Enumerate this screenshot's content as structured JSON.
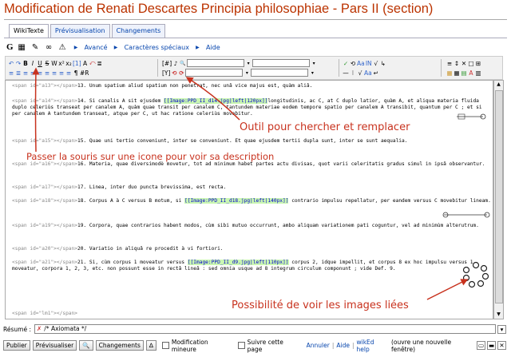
{
  "page": {
    "title": "Modification de Renati Descartes Principia philosophiae - Pars II (section)"
  },
  "tabs": [
    {
      "label": "WikiTexte",
      "active": true
    },
    {
      "label": "Prévisualisation",
      "active": false
    },
    {
      "label": "Changements",
      "active": false
    }
  ],
  "toolbar": {
    "g_label": "G",
    "advanced_label": "Avancé",
    "special_chars_label": "Caractères spéciaux",
    "help_label": "Aide",
    "row1": [
      "↶",
      "↷",
      "B",
      "I",
      "U",
      "S",
      "W",
      "x²",
      "x₂",
      "[1]",
      "A",
      "⤺",
      "≣"
    ],
    "row2": [
      "≡",
      "≣",
      "≡",
      "≡",
      "≡",
      "≡",
      "≡",
      "≡",
      "≡",
      "¶",
      "#R"
    ],
    "search_row1": [
      "[#]",
      "♪",
      "🔍"
    ],
    "search_row2": [
      "[Y]",
      "⟲",
      "⟳"
    ],
    "group3_row1": [
      "✓",
      "⟲",
      "Aa",
      "IN",
      "√",
      "↳"
    ],
    "group3_row2": [
      "—",
      "⁝",
      "√",
      "Aa",
      "↵"
    ],
    "group4_row1": [
      "≡",
      "↕",
      "✕",
      "□",
      "⊞"
    ],
    "group4_row2": [
      "▦",
      "▦",
      "▤",
      "A",
      "▥"
    ]
  },
  "editor": {
    "lines": [
      {
        "id": "a13",
        "text": "13. Unum spatium aliud spatium non penetrat, nec unâ vice majus est, quàm aliâ."
      },
      {
        "id": "a14",
        "pre": "14. Si canalis A sit ejusdem ",
        "img": "[[Image:PPD_II_d14.jpg|left|120px]]",
        "post": "longitudinis, ac C, at C duplo latior, quàm A, et aliqua materia fluida duplo celeriùs transeat per canalem A, quàm quae transit per canalem C, tantundem materiae eodem tempore spatio per canalem A transibit, quantum per C ; et si per canalem A tantundem transeat, atque per C, ut hac ratione celeriùs movebitur."
      },
      {
        "id": "a15",
        "text": "15. Quae uni tertio conveniunt, inter se conveniunt. Et quae ejusdem tertii dupla sunt, inter se sunt aequalia."
      },
      {
        "id": "a16",
        "text": "16. Materia, quae diversimodè movetur, tot ad minimum habet partes actu divisas, quot varii celeritatis gradus simul in ipsâ observantur."
      },
      {
        "id": "a17",
        "text": "17. Linea, inter duo puncta brevissima, est recta."
      },
      {
        "id": "a18",
        "pre": "18. Corpus A à C versus B motum, si ",
        "img": "[[Image:PPD_II_d18.jpg|left|140px]]",
        "post": " contrario impulsu repellatur, per eandem versus C movebitur lineam."
      },
      {
        "id": "a19",
        "text": "19. Corpora, quae contrarios habent modos, cùm sibi mutuo occurrunt, ambo aliquam variationem pati coguntur, vel ad minimùm alterutrum."
      },
      {
        "id": "a20",
        "text": "20. Variatio in aliquâ re procedit à vi fortiori."
      },
      {
        "id": "a21",
        "pre": "21. Si, cùm corpus 1 moveatur versus ",
        "img": "[[Image:PPD_II_d9.jpg|left|110px]]",
        "post": " corpus 2, idque impellit, et corpus 8 ex hoc impulsu versus 1 moveatur, corpora 1, 2, 3, etc. non possunt esse in rectâ lineâ : sed omnia usque ad 8 integrum circulum componunt ; vide Def. 9."
      },
      {
        "id": "lm1",
        "text": ""
      }
    ]
  },
  "annotations": {
    "search_replace": "Outil pour chercher et remplacer",
    "hover_icon": "Passer la souris sur une icone pour voir sa description",
    "linked_images": "Possibilité de voir les images liées"
  },
  "summary": {
    "label": "Résumé :",
    "value": "/* Axiomata */"
  },
  "actions": {
    "publish": "Publier",
    "preview": "Prévisualiser",
    "changes": "Changements",
    "minor_edit": "Modification mineure",
    "watch": "Suivre cette page",
    "cancel": "Annuler",
    "help": "Aide",
    "wiked_help": "wikEd help",
    "new_window": "(ouvre une nouvelle fenêtre)"
  },
  "colors": {
    "title": "#bb3300",
    "annotation": "#c8321e",
    "image_highlight": "#caf7b2",
    "link": "#0645ad"
  }
}
